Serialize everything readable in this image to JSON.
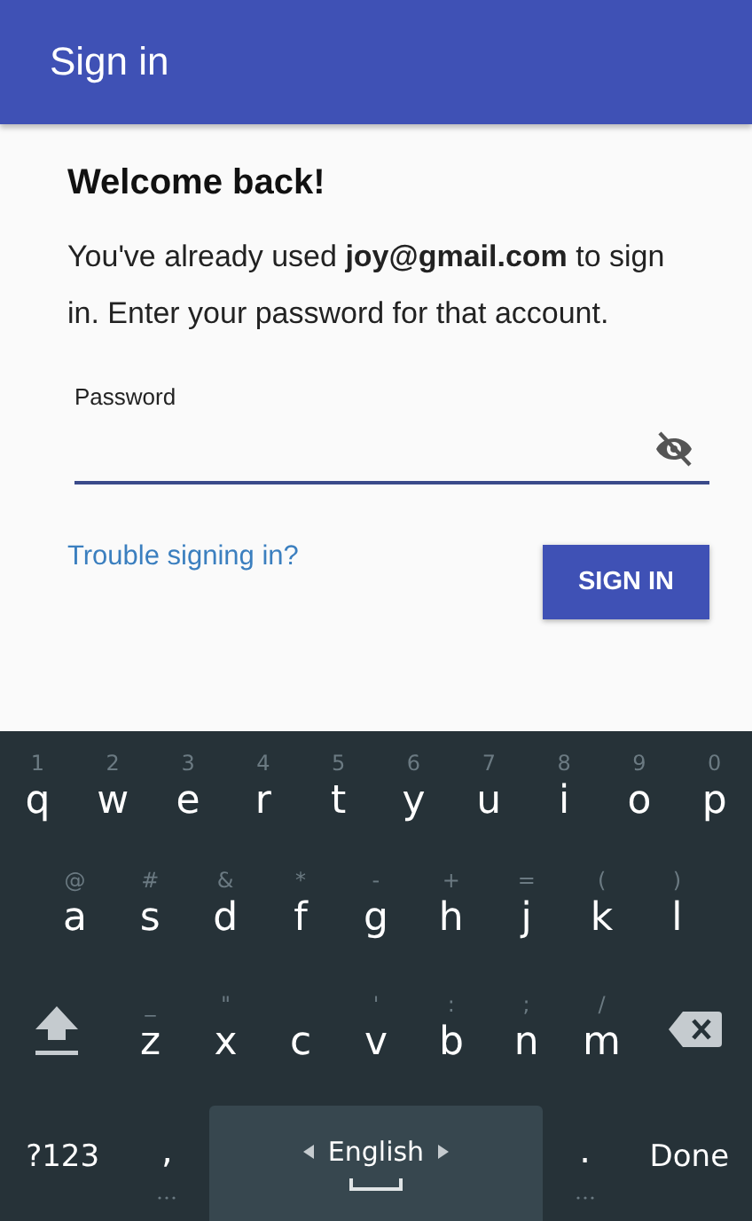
{
  "app_bar": {
    "title": "Sign in"
  },
  "card": {
    "heading": "Welcome back!",
    "message": "You've already used **joy@gmail.com** to sign in. Enter your password for that account.",
    "password_field": {
      "label": "Password",
      "visible": false
    },
    "trouble_link": "Trouble signing in?",
    "sign_in_button": "SIGN IN"
  },
  "keyboard": {
    "rows": [
      [
        {
          "kind": "letter",
          "label": "q",
          "hint": "1"
        },
        {
          "kind": "letter",
          "label": "w",
          "hint": "2"
        },
        {
          "kind": "letter",
          "label": "e",
          "hint": "3"
        },
        {
          "kind": "letter",
          "label": "r",
          "hint": "4"
        },
        {
          "kind": "letter",
          "label": "t",
          "hint": "5"
        },
        {
          "kind": "letter",
          "label": "y",
          "hint": "6"
        },
        {
          "kind": "letter",
          "label": "u",
          "hint": "7"
        },
        {
          "kind": "letter",
          "label": "i",
          "hint": "8"
        },
        {
          "kind": "letter",
          "label": "o",
          "hint": "9"
        },
        {
          "kind": "letter",
          "label": "p",
          "hint": "0"
        }
      ],
      [
        {
          "kind": "letter",
          "label": "a",
          "hint": "@"
        },
        {
          "kind": "letter",
          "label": "s",
          "hint": "#"
        },
        {
          "kind": "letter",
          "label": "d",
          "hint": "&"
        },
        {
          "kind": "letter",
          "label": "f",
          "hint": "*"
        },
        {
          "kind": "letter",
          "label": "g",
          "hint": "-"
        },
        {
          "kind": "letter",
          "label": "h",
          "hint": "+"
        },
        {
          "kind": "letter",
          "label": "j",
          "hint": "="
        },
        {
          "kind": "letter",
          "label": "k",
          "hint": "("
        },
        {
          "kind": "letter",
          "label": "l",
          "hint": ")"
        }
      ],
      [
        {
          "kind": "shift"
        },
        {
          "kind": "letter",
          "label": "z",
          "hint": "_"
        },
        {
          "kind": "letter",
          "label": "x",
          "hint": "\""
        },
        {
          "kind": "letter",
          "label": "c"
        },
        {
          "kind": "letter",
          "label": "v",
          "hint": "'"
        },
        {
          "kind": "letter",
          "label": "b",
          "hint": ":"
        },
        {
          "kind": "letter",
          "label": "n",
          "hint": ";"
        },
        {
          "kind": "letter",
          "label": "m",
          "hint": "/"
        },
        {
          "kind": "backspace"
        }
      ]
    ],
    "bottom_row": [
      {
        "kind": "mode",
        "label": "?123"
      },
      {
        "kind": "punct",
        "label": ","
      },
      {
        "kind": "space",
        "label": "English"
      },
      {
        "kind": "punct",
        "label": "."
      },
      {
        "kind": "action",
        "label": "Done"
      }
    ]
  }
}
